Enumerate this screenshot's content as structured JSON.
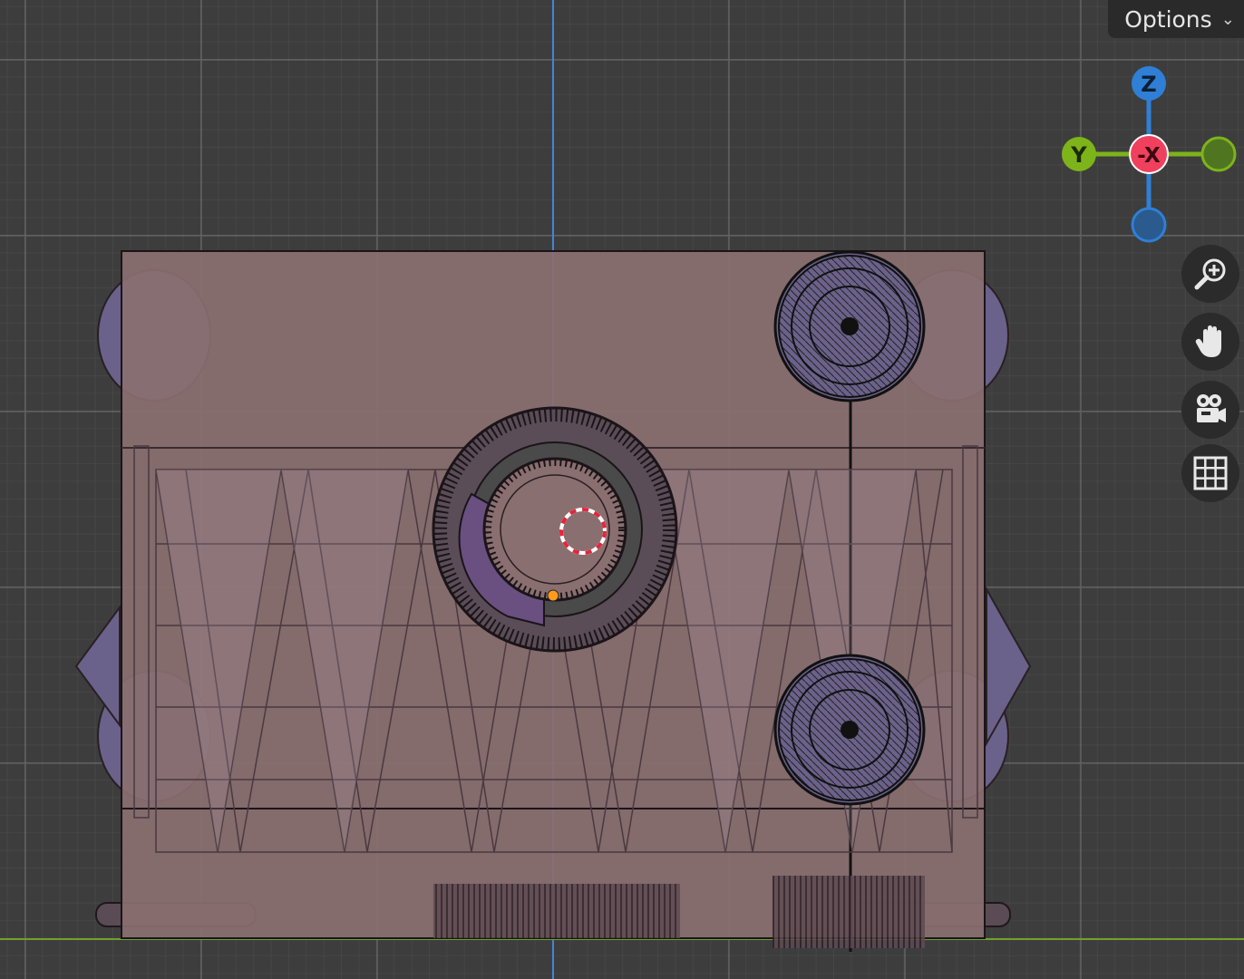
{
  "header": {
    "options_label": "Options",
    "options_chevron": "chevron-down-icon"
  },
  "gizmo": {
    "z_label": "Z",
    "y_label": "Y",
    "x_label": "-X",
    "colors": {
      "z": "#2f7fd6",
      "y": "#7cb41a",
      "x": "#f0405e",
      "neg_z": "#2a5a8e",
      "neg_y": "#4f7520"
    }
  },
  "nav_tools": [
    {
      "name": "zoom-icon"
    },
    {
      "name": "pan-hand-icon"
    },
    {
      "name": "camera-view-icon"
    },
    {
      "name": "orthographic-grid-icon"
    }
  ],
  "scene": {
    "view_axis_colors": {
      "vertical": "#3f86d6",
      "horizontal": "#6ea22a"
    },
    "object_fill": "#8a6f70",
    "wire_color": "#2a1f24",
    "cursor_color": "#e8233a",
    "origin_color": "#ff9a1a"
  }
}
